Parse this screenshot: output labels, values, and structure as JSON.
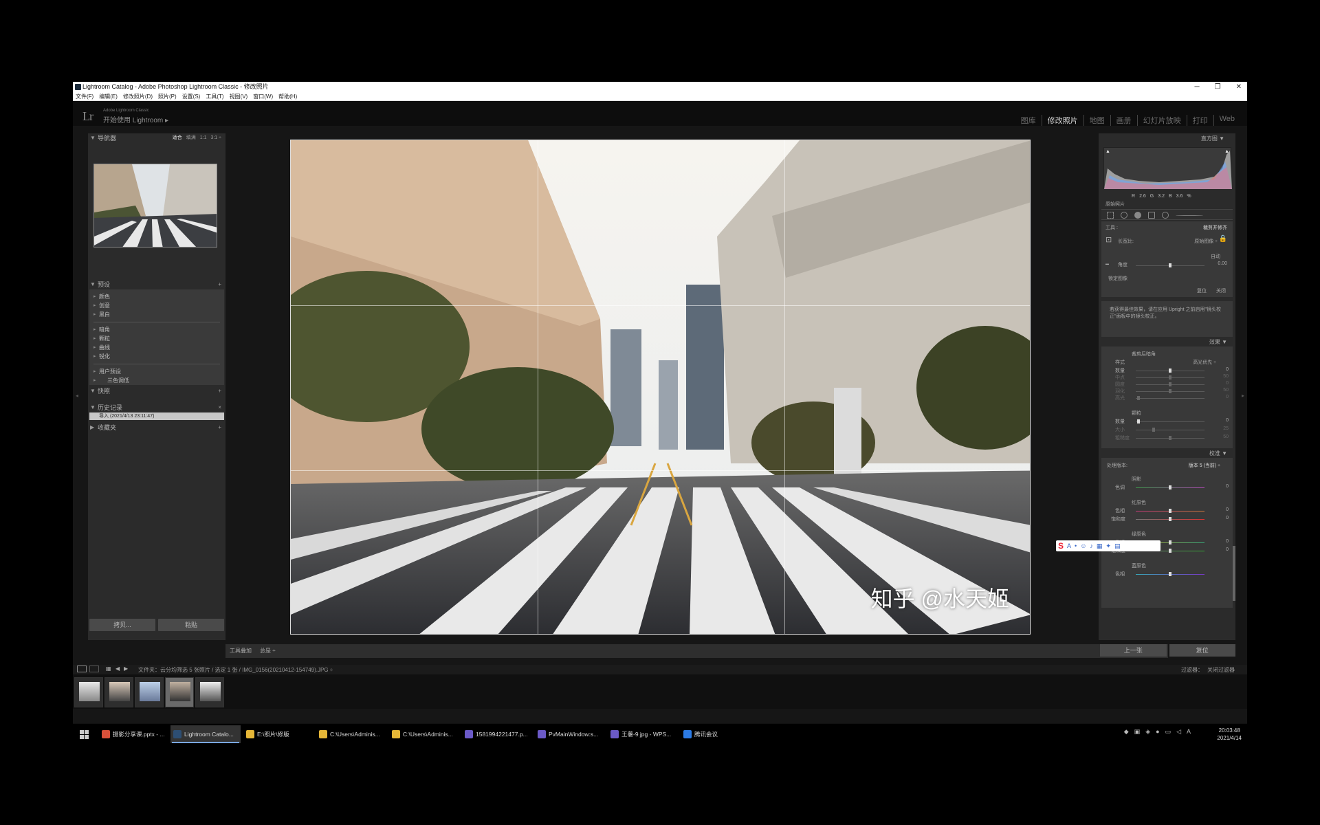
{
  "window": {
    "title": "Lightroom Catalog - Adobe Photoshop Lightroom Classic - 修改照片",
    "menu": [
      "文件(F)",
      "编辑(E)",
      "修改照片(D)",
      "照片(P)",
      "设置(S)",
      "工具(T)",
      "视图(V)",
      "窗口(W)",
      "帮助(H)"
    ],
    "controls": [
      "─",
      "❐",
      "✕"
    ]
  },
  "identity": {
    "logo": "Lr",
    "adobe_line": "Adobe Lightroom Classic",
    "start_label": "开始使用 Lightroom ▸"
  },
  "modules": [
    {
      "label": "图库",
      "active": false
    },
    {
      "label": "修改照片",
      "active": true
    },
    {
      "label": "地图",
      "active": false
    },
    {
      "label": "画册",
      "active": false
    },
    {
      "label": "幻灯片放映",
      "active": false
    },
    {
      "label": "打印",
      "active": false
    },
    {
      "label": "Web",
      "active": false
    }
  ],
  "left_panel": {
    "navigator": {
      "title": "导航器",
      "options": [
        "适合",
        "填满",
        "1:1",
        "3:1 ÷"
      ]
    },
    "presets": {
      "title": "预设",
      "add": "+",
      "group1": [
        "颜色",
        "创意",
        "黑白"
      ],
      "group2": [
        "暗角",
        "颗粒",
        "曲线",
        "锐化"
      ],
      "user_group": "用户预设",
      "user_item": "三色调低"
    },
    "snapshots": {
      "title": "快照",
      "add": "+"
    },
    "history": {
      "title": "历史记录",
      "close": "×",
      "selected": "导入 (2021/4/13 23:11:47)"
    },
    "collections": {
      "title": "收藏夹",
      "add": "+"
    },
    "copy_button": "拷贝...",
    "paste_button": "粘贴"
  },
  "photo": {
    "watermark": "知乎 @水天姬"
  },
  "toolbar": {
    "tool_overlay": "工具叠加",
    "overlay_value": "总是 ÷",
    "done": "完成"
  },
  "right_panel": {
    "histogram_title": "直方图 ▼",
    "hist_values": {
      "r_label": "R",
      "r": "2.6",
      "g_label": "G",
      "g": "3.2",
      "b_label": "B",
      "b": "3.6",
      "unit": "%"
    },
    "original_photo": "原始照片",
    "crop": {
      "tool_label": "工具 :",
      "tool_name": "裁剪并修齐",
      "aspect_label": "长宽比:",
      "aspect_value": "原始图像 ÷",
      "auto": "自动",
      "angle_label": "角度",
      "angle_value": "0.00",
      "constrain": "锁定图像",
      "reset": "复位",
      "close": "关闭"
    },
    "help_text": "若获得最佳效果，请在应用 Upright 之前启用\"镜头校正\"面板中的镜头校正。",
    "effects": {
      "title": "效果 ▼",
      "vignette_title": "裁剪后暗角",
      "style_label": "样式",
      "style_value": "高光优先 ÷",
      "vig_rows": [
        {
          "label": "数量",
          "value": "0"
        },
        {
          "label": "中点",
          "value": "50"
        },
        {
          "label": "圆度",
          "value": "0"
        },
        {
          "label": "羽化",
          "value": "50"
        },
        {
          "label": "高光",
          "value": "0"
        }
      ],
      "grain_title": "颗粒",
      "grain_rows": [
        {
          "label": "数量",
          "value": "0"
        },
        {
          "label": "大小",
          "value": "25"
        },
        {
          "label": "粗糙度",
          "value": "50"
        }
      ]
    },
    "calibration": {
      "title": "校准 ▼",
      "process_label": "处理版本:",
      "process_value": "版本 5 (当前) ÷",
      "shadows": "阴影",
      "tint_label": "色调",
      "tint_value": "0",
      "red": "红原色",
      "green": "绿原色",
      "blue": "蓝原色",
      "hue_label": "色相",
      "sat_label": "饱和度",
      "zero": "0"
    },
    "prev_button": "上一张",
    "reset_button": "复位"
  },
  "filmstrip": {
    "path": "文件夹：云分均筛选   5 张照片 / 选定 1 张 / IMG_0156(20210412-154749).JPG ÷",
    "filter_label": "过滤器：",
    "filter_value": "关闭过滤器",
    "selected_index": 3,
    "thumb_count": 5
  },
  "taskbar": {
    "items": [
      {
        "label": "摄影分享课.pptx - ...",
        "color": "#d9513a",
        "active": false
      },
      {
        "label": "Lightroom Catalo...",
        "color": "#2d4e73",
        "active": true
      },
      {
        "label": "E:\\照片\\修版",
        "color": "#e6b737",
        "active": false
      },
      {
        "label": "C:\\Users\\Adminis...",
        "color": "#e6b737",
        "active": false
      },
      {
        "label": "C:\\Users\\Adminis...",
        "color": "#e6b737",
        "active": false
      },
      {
        "label": "1581994221477.p...",
        "color": "#6b5ac8",
        "active": false
      },
      {
        "label": "PvMainWindow:s...",
        "color": "#6b5ac8",
        "active": false
      },
      {
        "label": "王薯-9.jpg - WPS...",
        "color": "#6b5ac8",
        "active": false
      },
      {
        "label": "腾讯会议",
        "color": "#2c7be5",
        "active": false
      }
    ],
    "time": "20:03:48",
    "date": "2021/4/14",
    "ime": "A"
  }
}
